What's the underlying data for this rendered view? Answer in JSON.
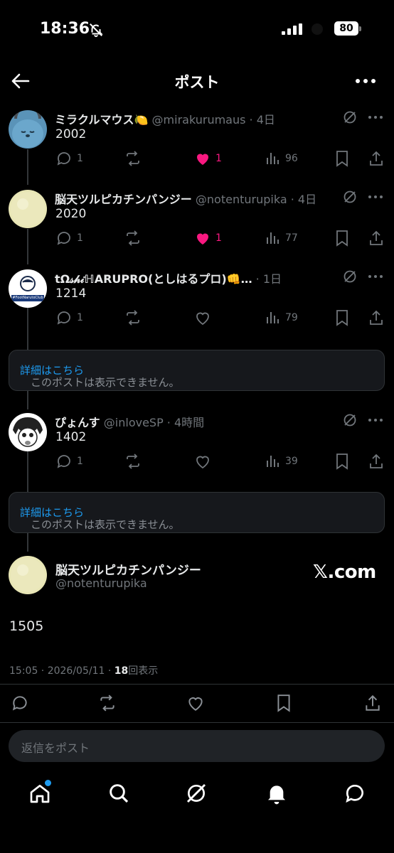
{
  "status_bar": {
    "time": "18:36",
    "battery": "80"
  },
  "header": {
    "title": "ポスト"
  },
  "posts": [
    {
      "name": "ミラクルマウス",
      "emoji": "🍋",
      "handle": "@mirakurumaus",
      "time": "4日",
      "text": "2002",
      "replies": "1",
      "likes": "1",
      "views": "96",
      "liked": true
    },
    {
      "name": "脳天ツルピカチンパンジー",
      "handle": "@notenturupika",
      "time": "4日",
      "text": "2020",
      "replies": "1",
      "likes": "1",
      "views": "77",
      "liked": true
    },
    {
      "name": "tΩ𝓈𝒽𝒾ℍARUPRO(としはるプロ)👊…",
      "handle": "",
      "time": "1日",
      "text": "1214",
      "replies": "1",
      "likes": "",
      "views": "79",
      "liked": false,
      "avatar_text": "#FootNarutoClub"
    },
    {
      "name": "ぴょんす",
      "handle": "@inloveSP",
      "time": "4時間",
      "text": "1402",
      "replies": "1",
      "likes": "",
      "views": "39",
      "liked": false
    }
  ],
  "unavailable": {
    "message": "このポストは表示できません。",
    "link": "詳細はこちら"
  },
  "main_post": {
    "name": "脳天ツルピカチンパンジー",
    "handle": "@notenturupika",
    "source": "𝕏.com",
    "text": "1505",
    "meta_prefix": "15:05 · 2026/05/11 · ",
    "views": "18",
    "views_suffix": "回表示"
  },
  "reply_box": {
    "placeholder": "返信をポスト"
  },
  "colors": {
    "like": "#f91880",
    "link": "#1d9bf0",
    "muted": "#71767b",
    "background": "#000000"
  },
  "bottom_nav": [
    "home-icon",
    "search-icon",
    "grok-icon",
    "notifications-icon",
    "messages-icon"
  ]
}
